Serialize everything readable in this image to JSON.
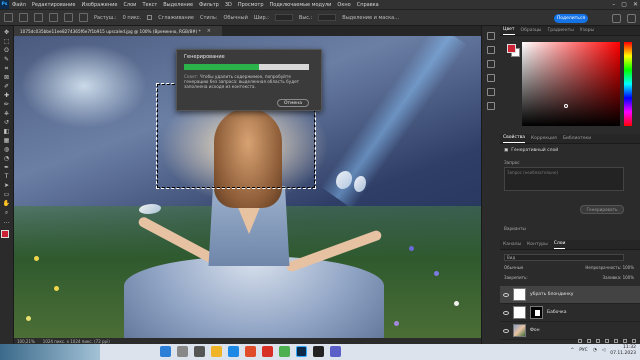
{
  "app": {
    "logo": "Ps"
  },
  "menu": [
    "Файл",
    "Редактирование",
    "Изображение",
    "Слои",
    "Текст",
    "Выделение",
    "Фильтр",
    "3D",
    "Просмотр",
    "Подключаемые модули",
    "Окно",
    "Справка"
  ],
  "options": {
    "feather_label": "Растуш.:",
    "feather_value": "0 пикс.",
    "antialias_label": "Сглаживание",
    "style_label": "Стиль:",
    "style_value": "Обычный",
    "width_label": "Шир.:",
    "height_label": "Выс.:",
    "mask_button": "Выделение и маска..."
  },
  "share_button": "Поделиться",
  "document": {
    "tab_title": "1075dc035bbe11ee8274365f6e7f1b915 upscaled.jpg @ 100% (Временно, RGB/8#) *",
    "close_glyph": "×"
  },
  "status": {
    "zoom": "100,21%",
    "info": "1024 пикс. x 1024 пикс. (72 ppi)"
  },
  "dialog": {
    "title": "Генерирование",
    "progress": 0.6,
    "tip_label": "Совет:",
    "tip_text": "Чтобы удалить содержимое, попробуйте генерацию без запроса: выделенная область будет заполнена исходя из контекста.",
    "cancel_button": "Отмена"
  },
  "color_panel": {
    "tabs": [
      "Цвет",
      "Образцы",
      "Градиенты",
      "Узоры"
    ],
    "foreground": "#cc2233"
  },
  "properties_panel": {
    "tabs": [
      "Свойства",
      "Коррекция",
      "Библиотеки"
    ],
    "title": "Генеративный слой",
    "prompt_label": "Запрос",
    "prompt_placeholder": "Запрос (необязательно)",
    "generate_button": "Генерировать",
    "variants_label": "Варианты"
  },
  "layers_panel": {
    "tabs": [
      "Каналы",
      "Контуры",
      "Слои"
    ],
    "filter_label": "Вид",
    "blend_mode": "Обычные",
    "opacity_label": "Непрозрачность:",
    "opacity_value": "100%",
    "lock_label": "Закрепить:",
    "fill_label": "Заливка:",
    "fill_value": "100%",
    "layers": [
      {
        "name": "убрать блондинку",
        "kind": "generative",
        "selected": true
      },
      {
        "name": "Бабочка",
        "kind": "masked",
        "selected": false
      },
      {
        "name": "Фон",
        "kind": "photo",
        "selected": false
      }
    ]
  },
  "taskbar": {
    "language": "РУС",
    "time": "11:32",
    "date": "07.11.2023"
  },
  "icons": {
    "tools": [
      "move-icon",
      "marquee-icon",
      "lasso-icon",
      "quick-select-icon",
      "crop-icon",
      "frame-icon",
      "eyedropper-icon",
      "healing-icon",
      "brush-icon",
      "stamp-icon",
      "history-brush-icon",
      "eraser-icon",
      "gradient-icon",
      "blur-icon",
      "dodge-icon",
      "pen-icon",
      "text-icon",
      "path-select-icon",
      "shape-icon",
      "hand-icon",
      "zoom-icon",
      "more-tools-icon"
    ],
    "tool_glyphs": [
      "✥",
      "⬚",
      "ʘ",
      "✎",
      "⌗",
      "⊠",
      "✐",
      "✚",
      "✏",
      "⎈",
      "↺",
      "◧",
      "▦",
      "◍",
      "◔",
      "✒",
      "T",
      "➤",
      "▭",
      "✋",
      "⌕",
      "…"
    ]
  }
}
